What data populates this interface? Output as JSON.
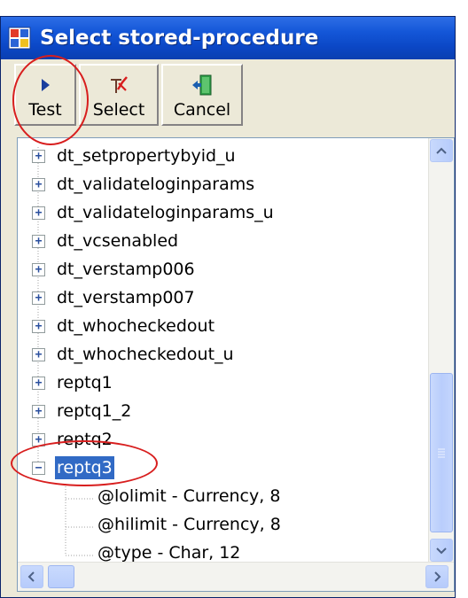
{
  "window": {
    "title": "Select stored-procedure",
    "icon": "window-icon"
  },
  "toolbar": {
    "buttons": [
      {
        "label": "Test",
        "icon": "play-arrow-icon"
      },
      {
        "label": "Select",
        "icon": "select-check-icon"
      },
      {
        "label": "Cancel",
        "icon": "exit-door-icon"
      }
    ]
  },
  "tree": {
    "nodes": [
      {
        "label": "dt_setpropertybyid_u",
        "expanded": false,
        "selected": false
      },
      {
        "label": "dt_validateloginparams",
        "expanded": false,
        "selected": false
      },
      {
        "label": "dt_validateloginparams_u",
        "expanded": false,
        "selected": false
      },
      {
        "label": "dt_vcsenabled",
        "expanded": false,
        "selected": false
      },
      {
        "label": "dt_verstamp006",
        "expanded": false,
        "selected": false
      },
      {
        "label": "dt_verstamp007",
        "expanded": false,
        "selected": false
      },
      {
        "label": "dt_whocheckedout",
        "expanded": false,
        "selected": false
      },
      {
        "label": "dt_whocheckedout_u",
        "expanded": false,
        "selected": false
      },
      {
        "label": "reptq1",
        "expanded": false,
        "selected": false
      },
      {
        "label": "reptq1_2",
        "expanded": false,
        "selected": false
      },
      {
        "label": "reptq2",
        "expanded": false,
        "selected": false
      },
      {
        "label": "reptq3",
        "expanded": true,
        "selected": true
      }
    ],
    "children": [
      {
        "label": "@lolimit - Currency, 8"
      },
      {
        "label": "@hilimit - Currency, 8"
      },
      {
        "label": "@type - Char, 12"
      }
    ]
  },
  "scrollbar": {
    "position": 0.85
  },
  "colors": {
    "titlebar": "#0b47c6",
    "selection": "#316ac5",
    "annotation": "#d81e1e"
  }
}
